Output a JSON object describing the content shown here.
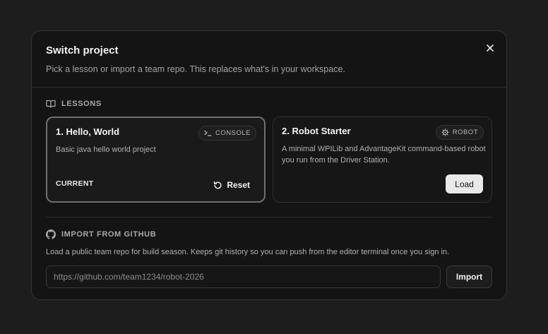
{
  "dialog": {
    "title": "Switch project",
    "subtitle": "Pick a lesson or import a team repo. This replaces what's in your workspace.",
    "close_icon": "close-icon"
  },
  "lessons": {
    "label": "LESSONS",
    "icon": "book-icon",
    "cards": [
      {
        "title": "1. Hello, World",
        "badge": "CONSOLE",
        "badge_icon": "terminal-icon",
        "description": "Basic java hello world project",
        "status": "CURRENT",
        "action": "Reset",
        "action_icon": "reset-icon",
        "current": true
      },
      {
        "title": "2. Robot Starter",
        "badge": "ROBOT",
        "badge_icon": "gear-icon",
        "description": "A minimal WPILib and AdvantageKit command-based robot you run from the Driver Station.",
        "action": "Load",
        "current": false
      }
    ]
  },
  "github": {
    "label": "IMPORT FROM GITHUB",
    "icon": "github-icon",
    "description": "Load a public team repo for build season. Keeps git history so you can push from the editor terminal once you sign in.",
    "input_placeholder": "https://github.com/team1234/robot-2026",
    "input_value": "",
    "import_label": "Import"
  },
  "colors": {
    "page_bg": "#1d1d1d",
    "dialog_bg": "#141414",
    "primary_button_bg": "#e9e9e9",
    "accent_border": "#6f6f6f"
  }
}
